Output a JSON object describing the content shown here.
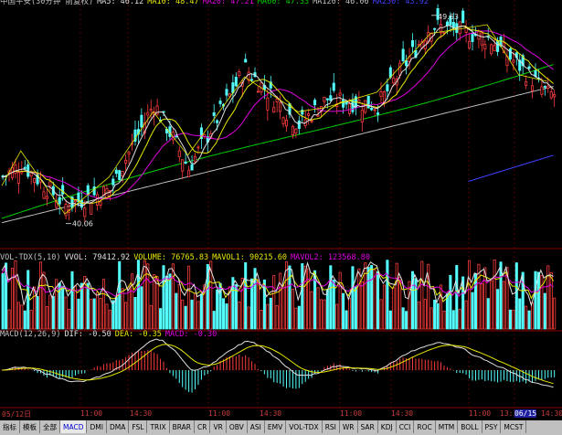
{
  "header_main": [
    {
      "text": "中国平安(30分钟 前复权)",
      "color": "#c0c0c0"
    },
    {
      "text": "MA5: 46.12",
      "color": "#e0e0e0"
    },
    {
      "text": "MA10: 48.47",
      "color": "#e8e800"
    },
    {
      "text": "MA20: 47.21",
      "color": "#e000e0"
    },
    {
      "text": "MA60: 47.33",
      "color": "#00d000"
    },
    {
      "text": "MA120: 46.06",
      "color": "#c0c0c0"
    },
    {
      "text": "MA250: 43.92",
      "color": "#4040ff"
    }
  ],
  "header_vol": [
    {
      "text": "VOL-TDX(5,10)",
      "color": "#c0c0c0"
    },
    {
      "text": "VVOL: 79412.92",
      "color": "#e0e0e0"
    },
    {
      "text": "VOLUME: 76765.83",
      "color": "#e8e800"
    },
    {
      "text": "MAVOL1: 90215.60",
      "color": "#e8e800"
    },
    {
      "text": "MAVOL2: 123568.80",
      "color": "#e000e0"
    }
  ],
  "header_macd": [
    {
      "text": "MACD(12,26,9)",
      "color": "#c0c0c0"
    },
    {
      "text": "DIF: -0.50",
      "color": "#e0e0e0"
    },
    {
      "text": "DEA: -0.35",
      "color": "#e8e800"
    },
    {
      "text": "MACD: -0.30",
      "color": "#e000e0"
    }
  ],
  "time_axis": [
    "05/12日",
    "11:00",
    "14:30",
    "11:00",
    "14:30",
    "11:00",
    "14:30",
    "11:00",
    "13:30",
    "11:00",
    "14:30",
    "11:00",
    "13:30",
    "06/15",
    "14:30"
  ],
  "tabs": [
    "指标",
    "模板",
    "全部",
    "MACD",
    "DMI",
    "DMA",
    "FSL",
    "TRIX",
    "BRAR",
    "CR",
    "VR",
    "OBV",
    "ASI",
    "EMV",
    "VOL-TDX",
    "RSI",
    "WR",
    "SAR",
    "KDJ",
    "CCI",
    "ROC",
    "MTM",
    "BOLL",
    "PSY",
    "MCST"
  ],
  "active_tab": "MACD",
  "annotations": {
    "high_label": "49.63",
    "low_label": "40.06"
  },
  "colors": {
    "up": "#ff3c3c",
    "down": "#54ffff",
    "ma5": "#e0e0e0",
    "ma10": "#e8e800",
    "ma20": "#e000e0",
    "ma60": "#00d000",
    "ma120": "#c0c0c0",
    "ma250": "#4040ff",
    "grid": "#8b0000"
  },
  "chart_data": [
    {
      "type": "candlestick",
      "series_names": [
        "MA5",
        "MA10",
        "MA20",
        "MA60",
        "MA120",
        "MA250"
      ],
      "ylim": [
        39.5,
        50.0
      ],
      "key_points": [
        {
          "idx": 0,
          "close": 42.2
        },
        {
          "idx": 6,
          "close": 42.8
        },
        {
          "idx": 20,
          "close": 40.9
        },
        {
          "idx": 34,
          "close": 41.6
        },
        {
          "idx": 48,
          "close": 45.6
        },
        {
          "idx": 59,
          "close": 42.6
        },
        {
          "idx": 77,
          "close": 47.2
        },
        {
          "idx": 94,
          "close": 44.6
        },
        {
          "idx": 103,
          "close": 45.8
        },
        {
          "idx": 119,
          "close": 45.5
        },
        {
          "idx": 136,
          "close": 49.2
        },
        {
          "idx": 154,
          "close": 48.6
        },
        {
          "idx": 164,
          "close": 47.3
        },
        {
          "idx": 173,
          "close": 46.0
        }
      ],
      "high": 49.63,
      "low": 40.06
    },
    {
      "type": "bar",
      "name": "VOL-TDX",
      "values_summary": {
        "VOLUME": 76765.83,
        "MAVOL1": 90215.6,
        "MAVOL2": 123568.8
      }
    },
    {
      "type": "bar",
      "name": "MACD",
      "values_summary": {
        "DIF": -0.5,
        "DEA": -0.35,
        "MACD": -0.3
      }
    }
  ]
}
